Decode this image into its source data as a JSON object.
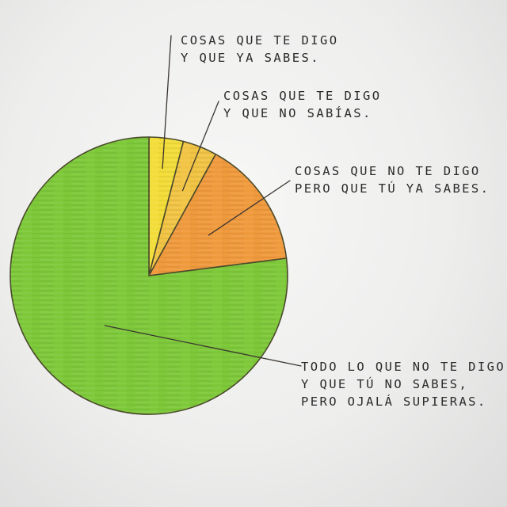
{
  "chart_data": {
    "type": "pie",
    "title": "",
    "series": [
      {
        "values": [
          {
            "label": "Cosas que te digo y que ya sabes.",
            "value": 4,
            "color": "#f2dd3a"
          },
          {
            "label": "Cosas que te digo y que no sabías.",
            "value": 4,
            "color": "#f1c445"
          },
          {
            "label": "Cosas que no te digo pero que tú ya sabes.",
            "value": 15,
            "color": "#f09a3e"
          },
          {
            "label": "Todo lo que no te digo y que tú no sabes, pero ojalá supieras.",
            "value": 77,
            "color": "#7ec93a"
          }
        ]
      }
    ]
  },
  "annotations": [
    {
      "lines": [
        "Cosas que te digo",
        "y que ya sabes."
      ]
    },
    {
      "lines": [
        "Cosas que te digo",
        "y que no sabías."
      ]
    },
    {
      "lines": [
        "Cosas que no te digo",
        "pero que tú ya sabes."
      ]
    },
    {
      "lines": [
        "Todo lo que no te digo",
        "y que tú no sabes,",
        "pero ojalá supieras."
      ]
    }
  ],
  "colors": {
    "outline": "#4a4a2a",
    "leader": "#3a3530"
  }
}
